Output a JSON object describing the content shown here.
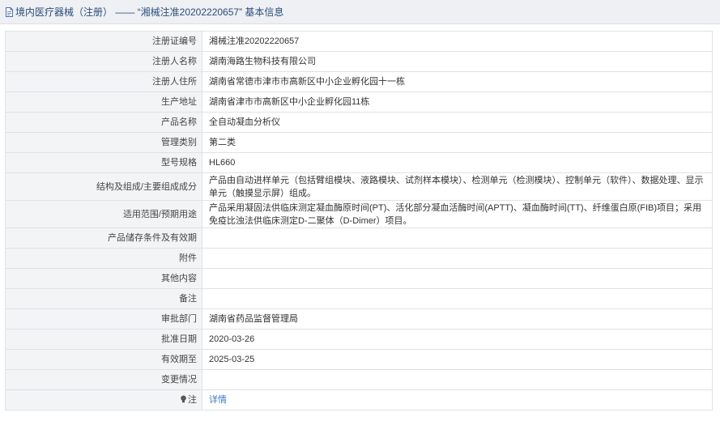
{
  "header": {
    "title": "境内医疗器械（注册） —— “湘械注准20202220657” 基本信息"
  },
  "rows": [
    {
      "label": "注册证编号",
      "value": "湘械注准20202220657"
    },
    {
      "label": "注册人名称",
      "value": "湖南海路生物科技有限公司"
    },
    {
      "label": "注册人住所",
      "value": "湖南省常德市津市市高新区中小企业孵化园十一栋"
    },
    {
      "label": "生产地址",
      "value": "湖南省津市市高新区中小企业孵化园11栋"
    },
    {
      "label": "产品名称",
      "value": "全自动凝血分析仪"
    },
    {
      "label": "管理类别",
      "value": "第二类"
    },
    {
      "label": "型号规格",
      "value": "HL660"
    },
    {
      "label": "结构及组成/主要组成成分",
      "value": "产品由自动进样单元（包括臂组模块、液路模块、试剂样本模块）、检测单元（检测模块）、控制单元（软件）、数据处理、显示单元（触摸显示屏）组成。"
    },
    {
      "label": "适用范围/预期用途",
      "value": "产品采用凝固法供临床测定凝血酶原时间(PT)、活化部分凝血活酶时间(APTT)、凝血酶时间(TT)、纤维蛋白原(FIB)项目；采用免疫比浊法供临床测定D-二聚体（D-Dimer）项目。"
    },
    {
      "label": "产品储存条件及有效期",
      "value": ""
    },
    {
      "label": "附件",
      "value": ""
    },
    {
      "label": "其他内容",
      "value": ""
    },
    {
      "label": "备注",
      "value": ""
    },
    {
      "label": "审批部门",
      "value": "湖南省药品监督管理局"
    },
    {
      "label": "批准日期",
      "value": "2020-03-26"
    },
    {
      "label": "有效期至",
      "value": "2025-03-25"
    },
    {
      "label": "变更情况",
      "value": ""
    }
  ],
  "note": {
    "label": "注",
    "link_text": "详情",
    "icon": "lightbulb-icon"
  },
  "icons": {
    "header": "document-icon"
  },
  "colors": {
    "link": "#3a78c7",
    "header_text": "#2a4d7a",
    "label_bg": "#f3f4f6",
    "border": "#dfe2e6"
  }
}
